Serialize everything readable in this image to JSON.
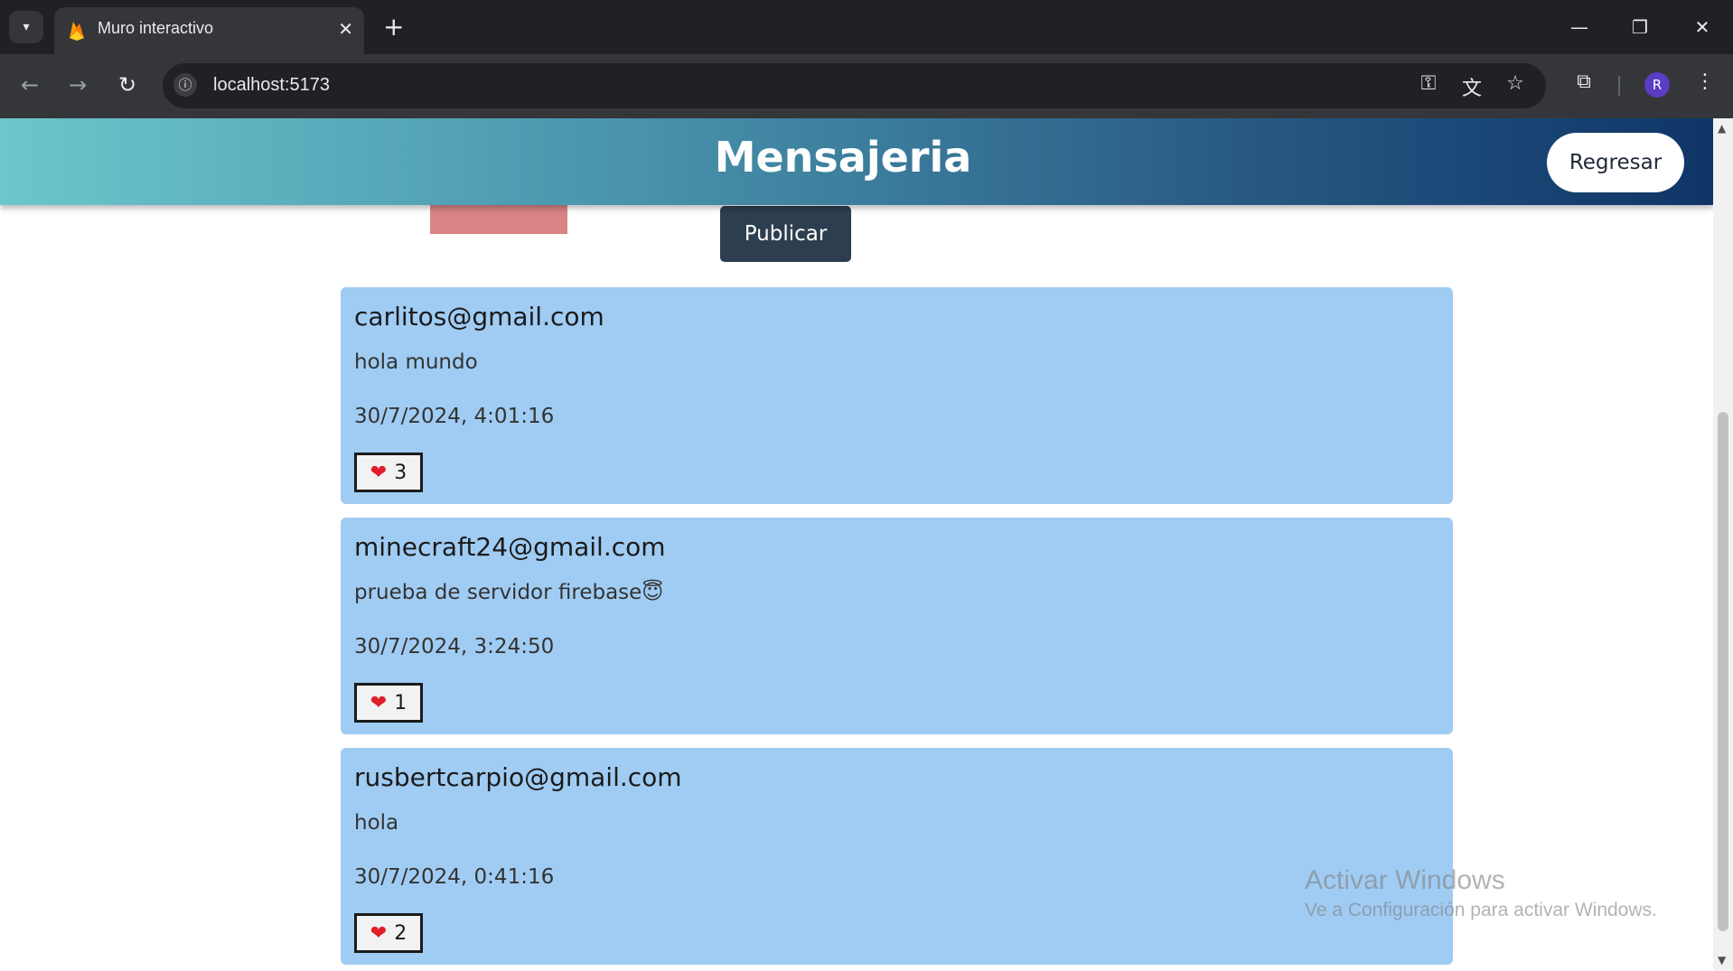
{
  "browser": {
    "tab_title": "Muro interactivo",
    "url": "localhost:5173",
    "profile_initial": "R",
    "icons": [
      "chevron-down-icon",
      "firebase-icon",
      "close-icon",
      "plus-icon",
      "minimize-icon",
      "restore-icon",
      "close-window-icon",
      "back-icon",
      "forward-icon",
      "reload-icon",
      "site-info-icon",
      "key-icon",
      "translate-icon",
      "star-icon",
      "extensions-icon",
      "menu-icon"
    ]
  },
  "header": {
    "title": "Mensajeria",
    "back_label": "Regresar"
  },
  "composer": {
    "publish_label": "Publicar"
  },
  "posts": [
    {
      "author": "carlitos@gmail.com",
      "text": "hola mundo",
      "date": "30/7/2024, 4:01:16",
      "likes": "3"
    },
    {
      "author": "minecraft24@gmail.com",
      "text": "prueba de servidor firebase😇",
      "date": "30/7/2024, 3:24:50",
      "likes": "1"
    },
    {
      "author": "rusbertcarpio@gmail.com",
      "text": "hola",
      "date": "30/7/2024, 0:41:16",
      "likes": "2"
    }
  ],
  "watermark": {
    "title": "Activar Windows",
    "subtitle": "Ve a Configuración para activar Windows."
  },
  "colors": {
    "header_start": "#6cc6cc",
    "header_end": "#0f3567",
    "post_bg": "#a0ccf3",
    "publish_bg": "#2d3e50",
    "like_heart": "#e11d2a"
  }
}
